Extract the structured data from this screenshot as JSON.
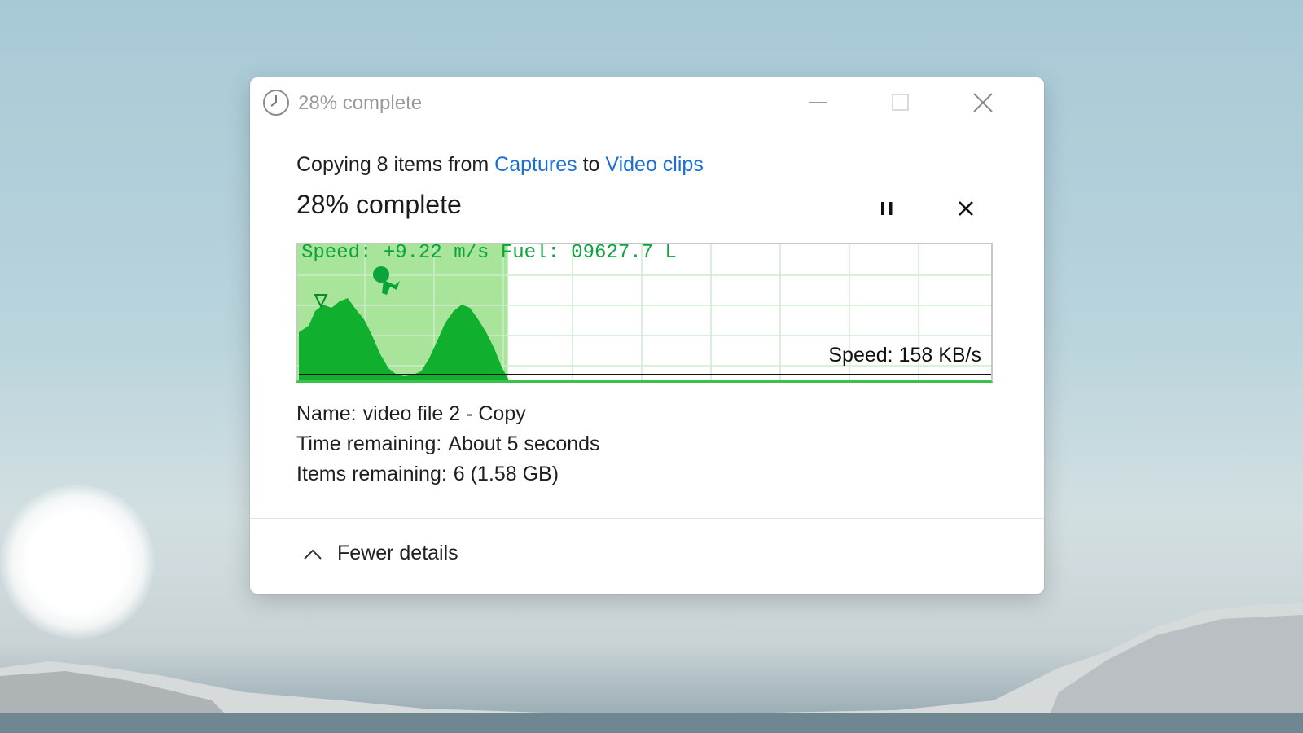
{
  "window": {
    "title": "28% complete",
    "icon": "clock-icon",
    "controls": [
      "minimize-icon",
      "maximize-icon",
      "close-icon"
    ]
  },
  "copy": {
    "prefix": "Copying 8 items from",
    "source": "Captures",
    "joiner": "to",
    "destination": "Video clips"
  },
  "progress": {
    "title": "28% complete",
    "percent": 28,
    "pause_icon": "pause-icon",
    "cancel_icon": "close-icon"
  },
  "graph": {
    "hud": "Speed: +9.22 m/s Fuel: 09627.7 L",
    "speed_label": "Speed: 158 KB/s",
    "fill_color": "#10b02e",
    "progress_color": "#a8e59a",
    "grid_color": "#cdeccf"
  },
  "details": {
    "name_label": "Name:",
    "name_value": "video file 2 - Copy",
    "time_label": "Time remaining:",
    "time_value": "About 5 seconds",
    "items_label": "Items remaining:",
    "items_value": "6 (1.58 GB)"
  },
  "footer": {
    "toggle_label": "Fewer details",
    "toggle_icon": "chevron-up-icon"
  },
  "colors": {
    "link": "#1a6fd6",
    "accent_green": "#3cc14c"
  }
}
